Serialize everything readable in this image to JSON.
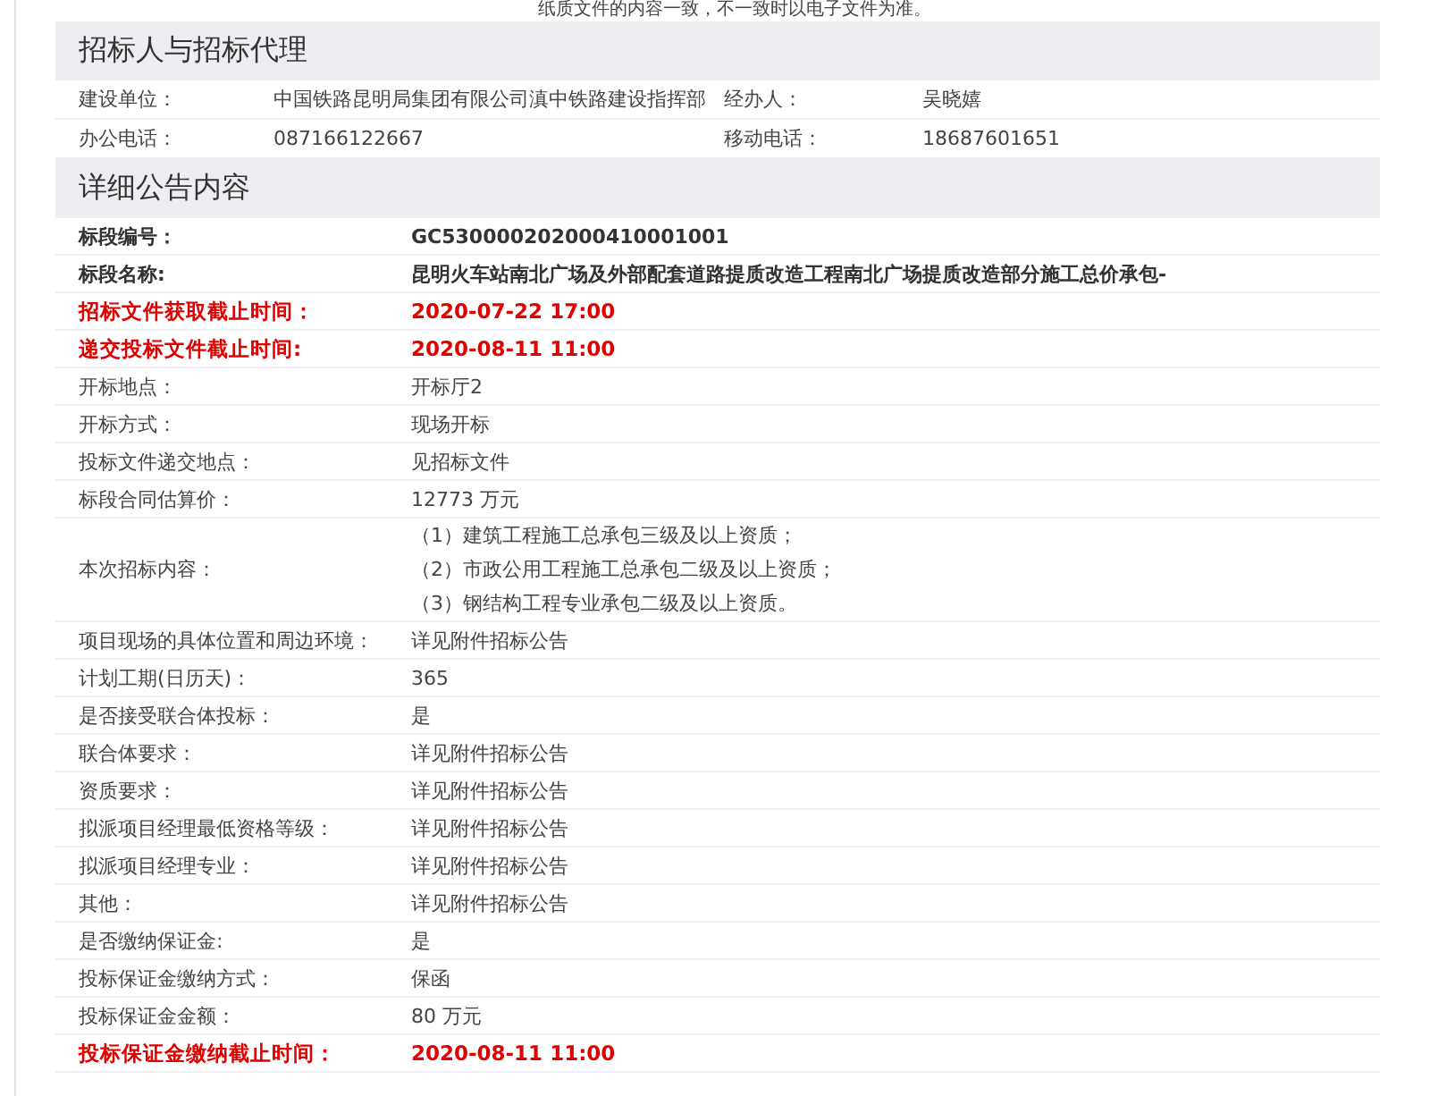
{
  "top_note": "纸质文件的内容一致，不一致时以电子文件为准。",
  "sections": [
    {
      "title": "招标人与招标代理",
      "kind": "contact",
      "rows": [
        {
          "label": "建设单位：",
          "value": "中国铁路昆明局集团有限公司滇中铁路建设指挥部",
          "label_2": "经办人：",
          "value_2": "吴晓嬉"
        },
        {
          "label": "办公电话：",
          "value": "087166122667",
          "label_2": "移动电话：",
          "value_2": "18687601651"
        }
      ]
    },
    {
      "title": "详细公告内容",
      "kind": "detail",
      "rows": [
        {
          "kind": "bold",
          "label": "标段编号：",
          "values": [
            "GC530000202000410001001"
          ]
        },
        {
          "kind": "bold",
          "label": "标段名称:",
          "values": [
            "昆明火车站南北广场及外部配套道路提质改造工程南北广场提质改造部分施工总价承包-"
          ]
        },
        {
          "kind": "deadline",
          "label": "招标文件获取截止时间：",
          "values": [
            "2020-07-22 17:00"
          ]
        },
        {
          "kind": "deadline",
          "label": "递交投标文件截止时间:",
          "values": [
            "2020-08-11 11:00"
          ]
        },
        {
          "kind": "normal",
          "label": "开标地点：",
          "values": [
            "开标厅2"
          ]
        },
        {
          "kind": "normal",
          "label": "开标方式：",
          "values": [
            "现场开标"
          ]
        },
        {
          "kind": "normal",
          "label": "投标文件递交地点：",
          "values": [
            "见招标文件"
          ]
        },
        {
          "kind": "normal",
          "label": "标段合同估算价：",
          "values": [
            "12773 万元"
          ]
        },
        {
          "kind": "normal",
          "label": "本次招标内容：",
          "values": [
            "（1）建筑工程施工总承包三级及以上资质；",
            "（2）市政公用工程施工总承包二级及以上资质；",
            "（3）钢结构工程专业承包二级及以上资质。"
          ]
        },
        {
          "kind": "normal",
          "label": "项目现场的具体位置和周边环境：",
          "values": [
            "详见附件招标公告"
          ]
        },
        {
          "kind": "normal",
          "label": "计划工期(日历天)：",
          "values": [
            "365"
          ]
        },
        {
          "kind": "normal",
          "label": "是否接受联合体投标：",
          "values": [
            "是"
          ]
        },
        {
          "kind": "normal",
          "label": "联合体要求：",
          "values": [
            "详见附件招标公告"
          ]
        },
        {
          "kind": "normal",
          "label": "资质要求：",
          "values": [
            "详见附件招标公告"
          ]
        },
        {
          "kind": "normal",
          "label": "拟派项目经理最低资格等级：",
          "values": [
            "详见附件招标公告"
          ]
        },
        {
          "kind": "normal",
          "label": "拟派项目经理专业：",
          "values": [
            "详见附件招标公告"
          ]
        },
        {
          "kind": "normal",
          "label": "其他：",
          "values": [
            "详见附件招标公告"
          ]
        },
        {
          "kind": "normal",
          "label": "是否缴纳保证金:",
          "values": [
            "是"
          ]
        },
        {
          "kind": "normal",
          "label": "投标保证金缴纳方式：",
          "values": [
            "保函"
          ]
        },
        {
          "kind": "normal",
          "label": "投标保证金金额：",
          "values": [
            "80 万元"
          ]
        },
        {
          "kind": "deadline",
          "label": "投标保证金缴纳截止时间：",
          "values": [
            "2020-08-11 11:00"
          ]
        }
      ]
    }
  ]
}
